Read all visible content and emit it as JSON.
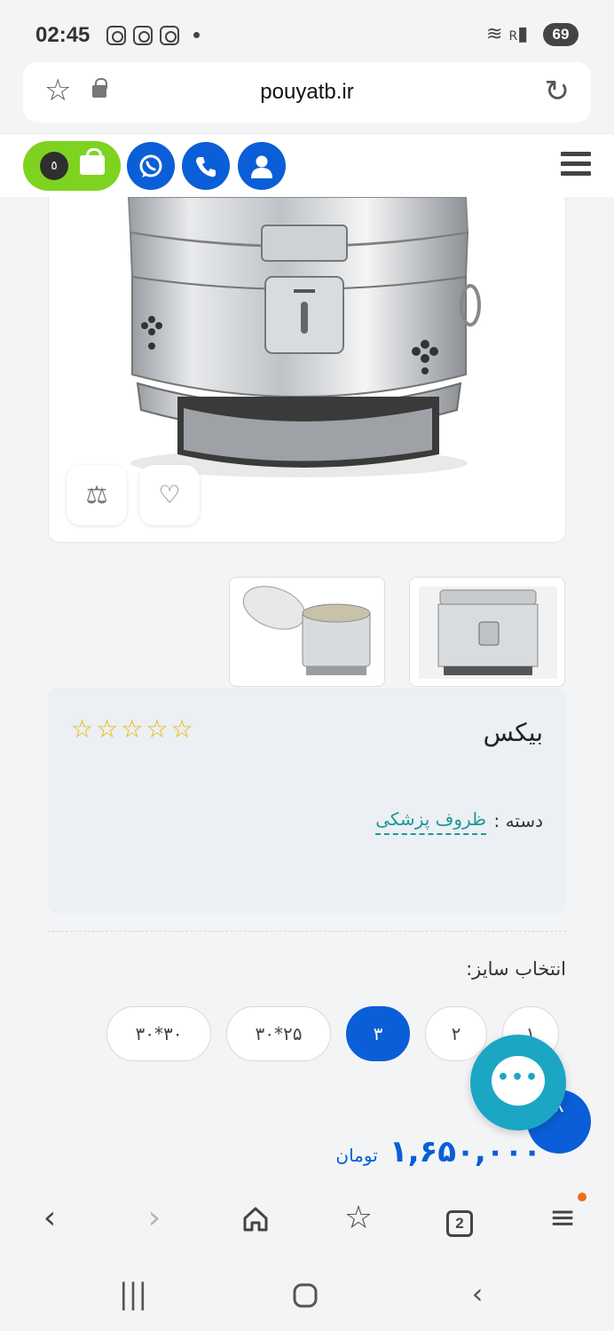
{
  "status_bar": {
    "time": "02:45",
    "battery": "69",
    "signal_text": "R"
  },
  "browser": {
    "url": "pouyatb.ir",
    "tabs_count": "2"
  },
  "header": {
    "cart_count": "٥"
  },
  "product": {
    "title": "بیکس",
    "category_label": "دسته :",
    "category": "ظروف پزشکی",
    "rating_stars": 0,
    "size_label": "انتخاب سایز:",
    "sizes": [
      "۱",
      "۲",
      "۳",
      "۳۰*۲۵",
      "۳۰*۳۰"
    ],
    "selected_size": "۳",
    "price": "۱,۶۵۰,۰۰۰",
    "price_unit": "تومان"
  },
  "colors": {
    "primary": "#0a5ed7",
    "cart_green": "#7ed321",
    "chat": "#1ba6c4",
    "link": "#1a9a9a",
    "star": "#e8b400"
  },
  "icons": {
    "favorite": "heart-icon",
    "compare": "scale-icon",
    "whatsapp": "whatsapp-icon",
    "phone": "phone-icon",
    "user": "user-icon",
    "menu": "hamburger-icon"
  }
}
